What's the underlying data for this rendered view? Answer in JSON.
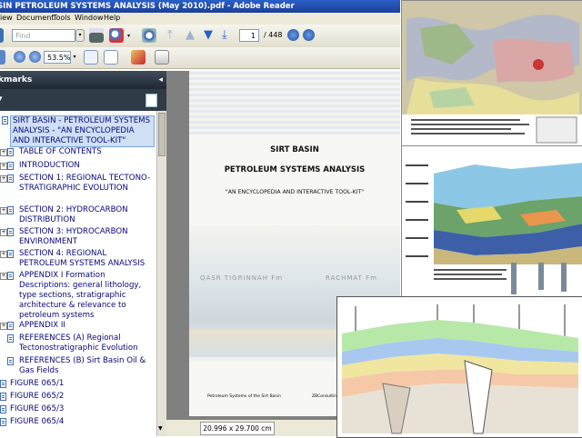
{
  "window": {
    "title": "SIN PETROLEUM SYSTEMS ANALYSIS (May 2010).pdf - Adobe Reader"
  },
  "menu": [
    "iew",
    "Document",
    "Tools",
    "Window",
    "Help"
  ],
  "toolbar": {
    "find_placeholder": "Find",
    "current_page": "1",
    "page_total": "/ 448",
    "zoom": "53.5%"
  },
  "sidebar": {
    "header": "kmarks",
    "items": [
      {
        "label": "SIRT BASIN - PETROLEUM SYSTEMS ANALYSIS - \"AN ENCYCLOPEDIA AND INTERACTIVE TOOL-KIT\"",
        "selected": true,
        "expandable": false
      },
      {
        "label": "TABLE OF CONTENTS",
        "expandable": true
      },
      {
        "label": "INTRODUCTION",
        "expandable": true
      },
      {
        "label": "SECTION 1: REGIONAL TECTONO-STRATIGRAPHIC EVOLUTION",
        "expandable": true
      },
      {
        "label": "SECTION 2: HYDROCARBON DISTRIBUTION",
        "expandable": true
      },
      {
        "label": "SECTION 3: HYDROCARBON ENVIRONMENT",
        "expandable": true
      },
      {
        "label": "SECTION 4: REGIONAL PETROLEUM SYSTEMS ANALYSIS",
        "expandable": true
      },
      {
        "label": "APPENDIX I Formation Descriptions: general lithology, type sections, stratigraphic architecture & relevance to petroleum systems",
        "expandable": true
      },
      {
        "label": "APPENDIX II",
        "expandable": true
      },
      {
        "label": "REFERENCES (A) Regional Tectonostratigraphic Evolution",
        "expandable": false
      },
      {
        "label": "REFERENCES (B) Sirt Basin Oil & Gas Fields",
        "expandable": false
      },
      {
        "label": "FIGURE 065/1",
        "expandable": false
      },
      {
        "label": "FIGURE 065/2",
        "expandable": false
      },
      {
        "label": "FIGURE 065/3",
        "expandable": false
      },
      {
        "label": "FIGURE 065/4",
        "expandable": false
      }
    ]
  },
  "document": {
    "title_line1": "SIRT BASIN",
    "title_line2": "PETROLEUM SYSTEMS ANALYSIS",
    "subtitle": "\"AN ENCYCLOPEDIA AND INTERACTIVE TOOL-KIT\"",
    "label_left": "QASR TIGRINNAH Fm",
    "label_right": "RACHMAT Fm",
    "footer_left": "Petroleum Systems of the Sirt Basin",
    "footer_right": "ZBConsulting-I",
    "page_size": "20.996 x 29.700 cm"
  },
  "colors": {
    "titlebar": "#1f4aa8",
    "selection": "#cfe0f4",
    "sidebar_header": "#2f3b47"
  }
}
